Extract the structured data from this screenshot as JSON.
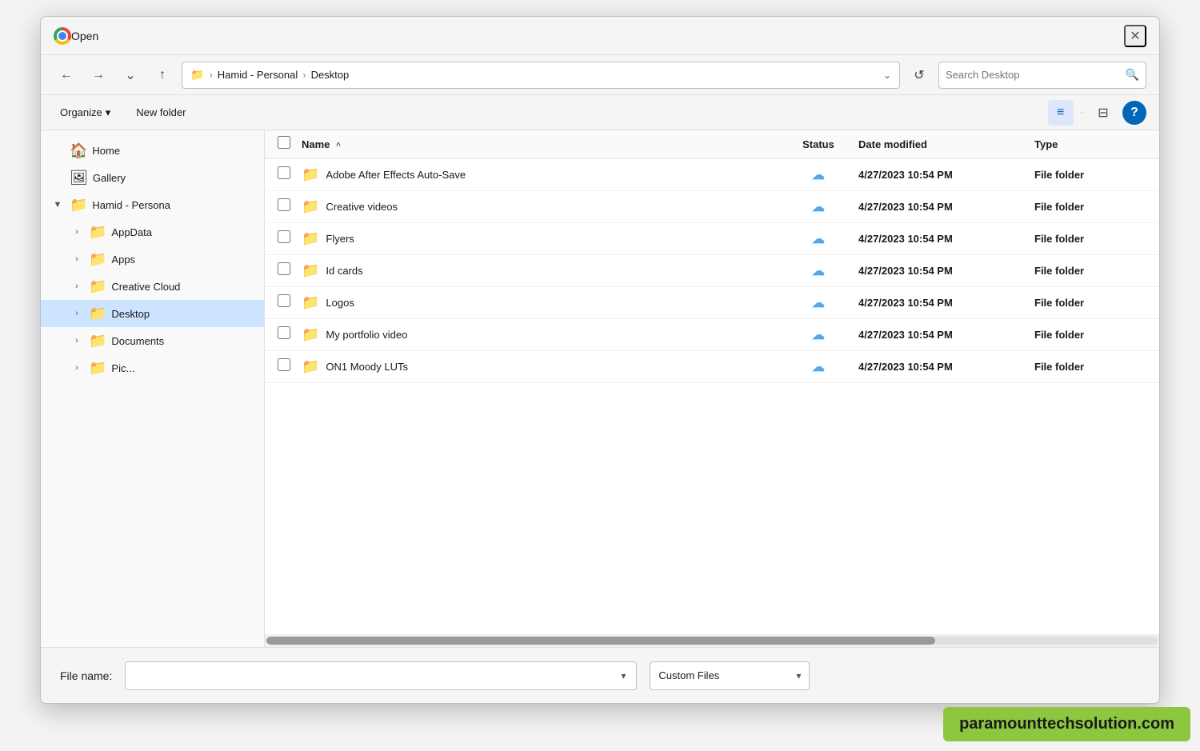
{
  "dialog": {
    "title": "Open",
    "close_label": "✕"
  },
  "toolbar": {
    "back_label": "←",
    "forward_label": "→",
    "dropdown_label": "⌄",
    "up_label": "↑",
    "address": {
      "folder_icon": "📁",
      "path_parts": [
        "Hamid - Personal",
        "Desktop"
      ],
      "separator": "›"
    },
    "address_chevron": "⌄",
    "refresh_label": "↺",
    "search_placeholder": "Search Desktop",
    "search_icon": "🔍"
  },
  "action_bar": {
    "organize_label": "Organize",
    "organize_arrow": "▾",
    "new_folder_label": "New folder",
    "view_icon_list": "≡",
    "view_icon_split": "⊟",
    "help_label": "?"
  },
  "columns": {
    "name": "Name",
    "status": "Status",
    "date_modified": "Date modified",
    "type": "Type"
  },
  "files": [
    {
      "name": "Adobe After Effects Auto-Save",
      "status": "☁",
      "date_modified": "4/27/2023 10:54 PM",
      "type": "File folder"
    },
    {
      "name": "Creative videos",
      "status": "☁",
      "date_modified": "4/27/2023 10:54 PM",
      "type": "File folder"
    },
    {
      "name": "Flyers",
      "status": "☁",
      "date_modified": "4/27/2023 10:54 PM",
      "type": "File folder"
    },
    {
      "name": "Id cards",
      "status": "☁",
      "date_modified": "4/27/2023 10:54 PM",
      "type": "File folder"
    },
    {
      "name": "Logos",
      "status": "☁",
      "date_modified": "4/27/2023 10:54 PM",
      "type": "File folder"
    },
    {
      "name": "My portfolio video",
      "status": "☁",
      "date_modified": "4/27/2023 10:54 PM",
      "type": "File folder"
    },
    {
      "name": "ON1 Moody LUTs",
      "status": "☁",
      "date_modified": "4/27/2023 10:54 PM",
      "type": "File folder"
    }
  ],
  "sidebar": {
    "items": [
      {
        "id": "home",
        "label": "Home",
        "icon": "🏠",
        "expandable": false,
        "indent": 0
      },
      {
        "id": "gallery",
        "label": "Gallery",
        "icon": "🖼",
        "expandable": false,
        "indent": 0
      },
      {
        "id": "hamid-personal",
        "label": "Hamid - Persona",
        "icon": "📁",
        "expandable": true,
        "expanded": true,
        "indent": 0
      },
      {
        "id": "appdata",
        "label": "AppData",
        "icon": "📁",
        "expandable": true,
        "expanded": false,
        "indent": 1
      },
      {
        "id": "apps",
        "label": "Apps",
        "icon": "📁",
        "expandable": true,
        "expanded": false,
        "indent": 1
      },
      {
        "id": "creative-cloud",
        "label": "Creative Cloud",
        "icon": "📁",
        "expandable": true,
        "expanded": false,
        "indent": 1
      },
      {
        "id": "desktop",
        "label": "Desktop",
        "icon": "📁",
        "expandable": true,
        "expanded": false,
        "indent": 1,
        "active": true
      },
      {
        "id": "documents",
        "label": "Documents",
        "icon": "📁",
        "expandable": true,
        "expanded": false,
        "indent": 1
      },
      {
        "id": "pictures",
        "label": "Pic...",
        "icon": "📁",
        "expandable": true,
        "expanded": false,
        "indent": 1
      }
    ]
  },
  "bottom_bar": {
    "file_name_label": "File name:",
    "file_name_value": "",
    "file_name_placeholder": "",
    "file_type_label": "Custom Files",
    "file_type_arrow": "▾",
    "file_name_arrow": "▾"
  },
  "watermark": {
    "text": "paramounttechsolution.com"
  }
}
